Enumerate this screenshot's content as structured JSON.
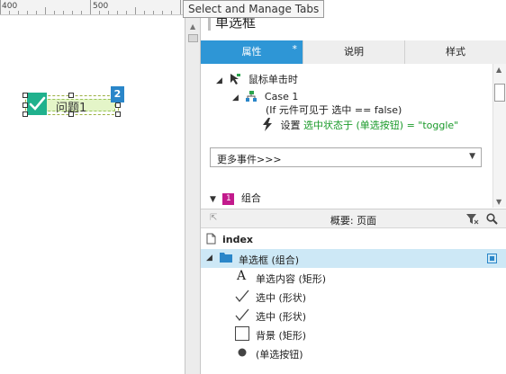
{
  "ruler": {
    "marks": [
      "400",
      "500"
    ]
  },
  "canvas": {
    "widget_label": "问题1",
    "badge": "2"
  },
  "tooltip": "Select and Manage Tabs",
  "panel": {
    "title": "单选框",
    "tabs": [
      {
        "label": "属性",
        "marker": "*"
      },
      {
        "label": "说明"
      },
      {
        "label": "样式"
      }
    ]
  },
  "events": {
    "trigger": "鼠标单击时",
    "case_name": "Case 1",
    "case_condition": "(If 元件可见于 选中 == false)",
    "action_prefix": "设置 ",
    "action_detail": "选中状态于 (单选按钮) = \"toggle\"",
    "more_events": "更多事件>>>",
    "group_badge": "1",
    "group_label": "组合"
  },
  "outline": {
    "header": "概要: 页面",
    "page": "index",
    "items": [
      {
        "label": "单选框 (组合)",
        "icon": "folder-icon",
        "selected": true
      },
      {
        "label": "单选内容 (矩形)",
        "icon": "text-icon"
      },
      {
        "label": "选中 (形状)",
        "icon": "checkmark-icon"
      },
      {
        "label": "选中 (形状)",
        "icon": "checkmark-icon"
      },
      {
        "label": "背景 (矩形)",
        "icon": "rectangle-icon"
      },
      {
        "label": "(单选按钮)",
        "icon": "dot-icon"
      }
    ]
  },
  "colors": {
    "accent": "#2e96d6",
    "checkbox_green": "#20b18d",
    "action_green": "#1a9a2a",
    "group_badge": "#c21a8c",
    "selection": "#cde8f6"
  }
}
